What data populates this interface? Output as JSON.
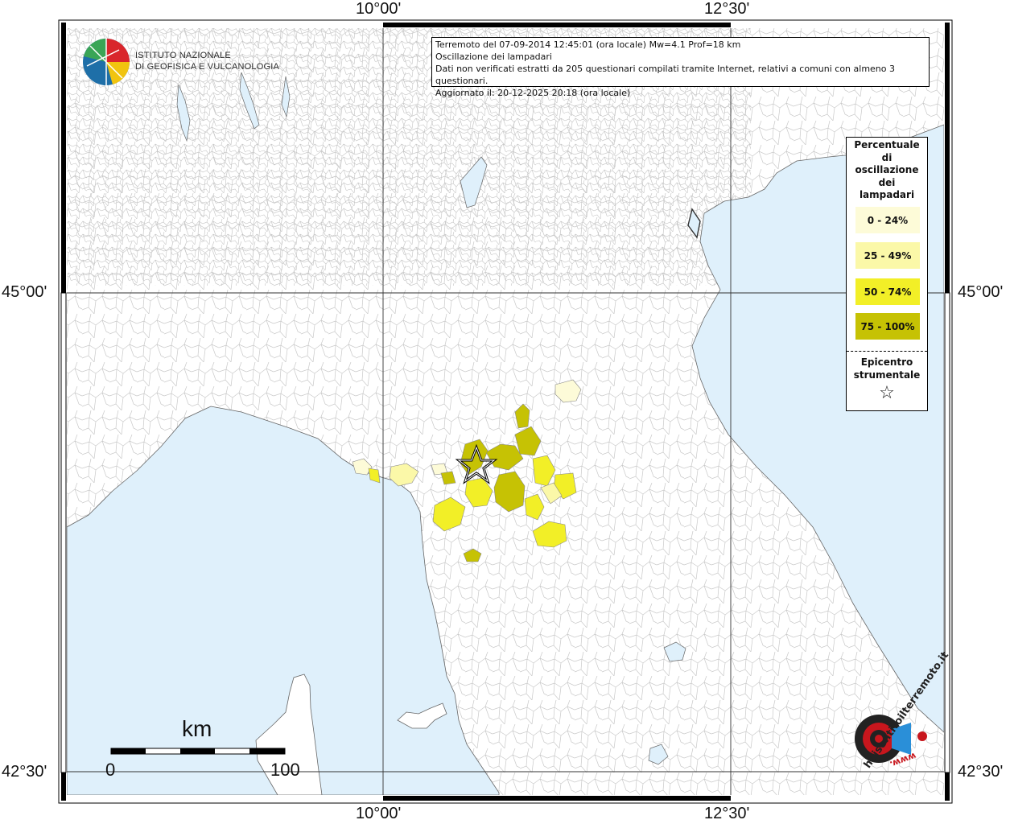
{
  "coordinates": {
    "top_left_lon": "10°00'",
    "top_right_lon": "12°30'",
    "bottom_left_lon": "10°00'",
    "bottom_right_lon": "12°30'",
    "left_upper_lat": "45°00'",
    "right_upper_lat": "45°00'",
    "left_lower_lat": "42°30'",
    "right_lower_lat": "42°30'"
  },
  "info": {
    "line1": "Terremoto del 07-09-2014 12:45:01 (ora locale) Mw=4.1 Prof=18 km",
    "line2": "Oscillazione dei lampadari",
    "line3": "Dati non verificati estratti da 205 questionari compilati tramite Internet, relativi a comuni con almeno 3 questionari.",
    "line4": "Aggiornato il: 20-12-2025 20:18 (ora locale)"
  },
  "legend": {
    "title_lines": [
      "Percentuale",
      "di",
      "oscillazione",
      "dei",
      "lampadari"
    ],
    "classes": [
      {
        "label": "0 - 24%",
        "color": "#fdfbd8"
      },
      {
        "label": "25 - 49%",
        "color": "#fbf8a8"
      },
      {
        "label": "50 - 74%",
        "color": "#f2ef27"
      },
      {
        "label": "75 - 100%",
        "color": "#c6c204"
      }
    ],
    "epicenter_lines": [
      "Epicentro",
      "strumentale"
    ],
    "epicenter_symbol": "☆"
  },
  "logo": {
    "institute_line1": "ISTITUTO NAZIONALE",
    "institute_line2": "DI GEOFISICA E VULCANOLOGIA",
    "hsit_text": "haisentitoilterremoto.it",
    "hsit_www": "www."
  },
  "scale": {
    "unit": "km",
    "start": "0",
    "end": "100"
  },
  "colors": {
    "sea": "#dff0fb",
    "land": "#ffffff",
    "boundaries": "#bfbfbf",
    "grid": "#333333"
  }
}
